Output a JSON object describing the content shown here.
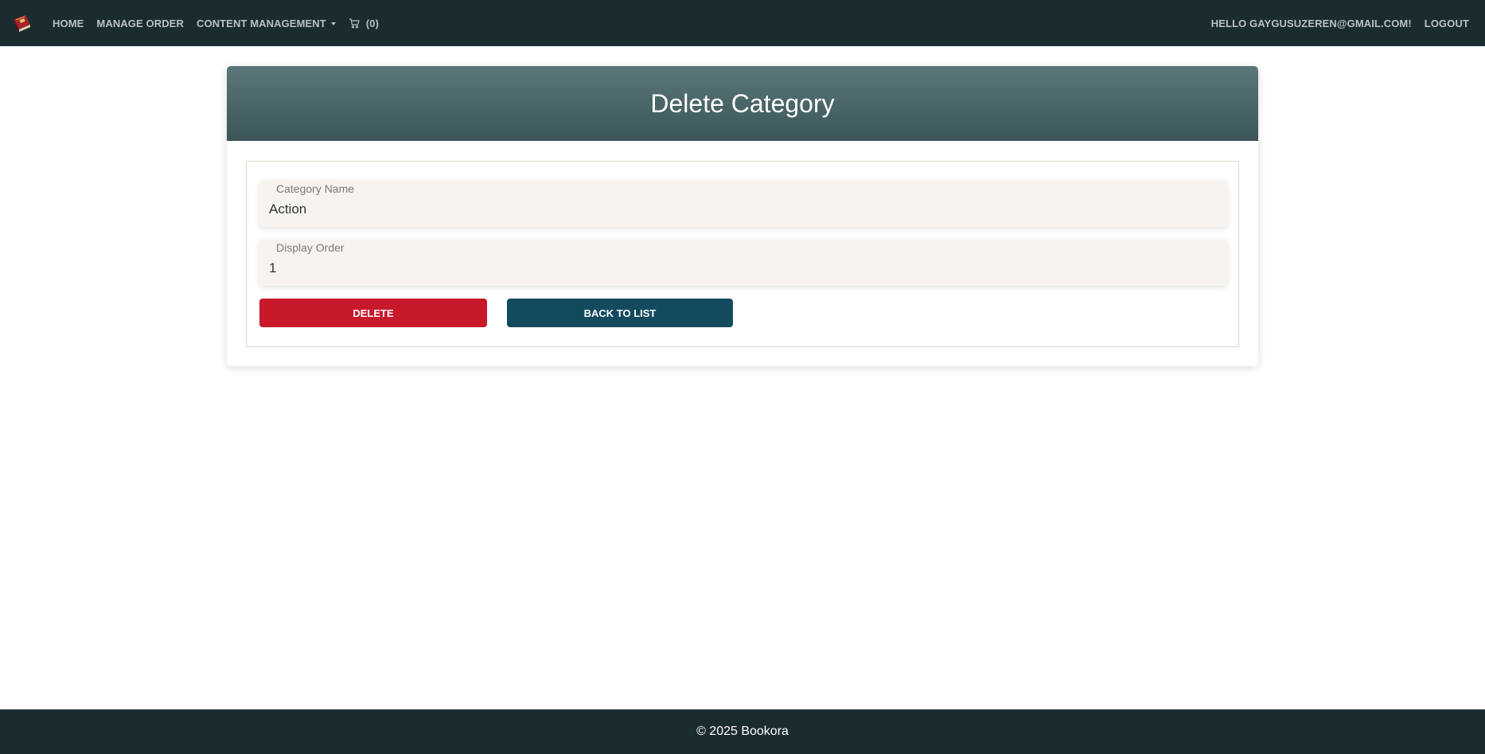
{
  "nav": {
    "logo": "book-logo",
    "links": [
      {
        "label": "HOME"
      },
      {
        "label": "MANAGE ORDER"
      },
      {
        "label": "CONTENT MANAGEMENT"
      }
    ],
    "cart_count": "(0)",
    "greeting": "HELLO GAYGUSUZEREN@GMAIL.COM!",
    "logout_label": "LOGOUT"
  },
  "page": {
    "title": "Delete Category"
  },
  "form": {
    "category_name": {
      "label": "Category Name",
      "value": "Action"
    },
    "display_order": {
      "label": "Display Order",
      "value": "1"
    },
    "delete_label": "DELETE",
    "back_label": "BACK TO LIST"
  },
  "footer": {
    "text": "© 2025 Bookora"
  },
  "colors": {
    "navbar": "#1b2c30",
    "header_gradient_top": "#5b7779",
    "header_gradient_bottom": "#3b5558",
    "delete_button": "#c8192b",
    "back_button": "#134a5e",
    "field_background": "#f7f4ef"
  }
}
